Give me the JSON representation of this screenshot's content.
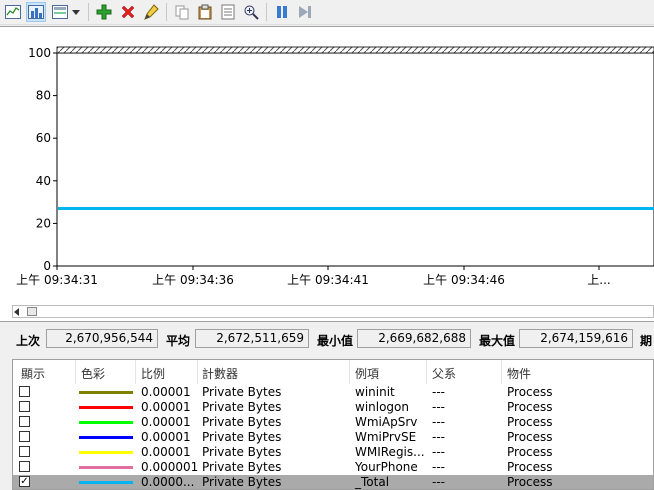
{
  "graph": {
    "y_ticks": [
      "100",
      "80",
      "60",
      "40",
      "20",
      "0"
    ],
    "x_ticks": [
      "上午 09:34:31",
      "上午 09:34:36",
      "上午 09:34:41",
      "上午 09:34:46",
      "上..."
    ],
    "line_color": "#00b4f0",
    "line_value": 27
  },
  "stats": {
    "last_label": "上次",
    "last_value": "2,670,956,544",
    "avg_label": "平均",
    "avg_value": "2,672,511,659",
    "min_label": "最小值",
    "min_value": "2,669,682,688",
    "max_label": "最大值",
    "max_value": "2,674,159,616",
    "duration_label": "期"
  },
  "table": {
    "headers": [
      "顯示",
      "色彩",
      "比例",
      "計數器",
      "例項",
      "父系",
      "物件"
    ],
    "rows": [
      {
        "checked": false,
        "color": "#808000",
        "scale": "0.00001",
        "counter": "Private Bytes",
        "instance": "wininit",
        "parent": "---",
        "object": "Process"
      },
      {
        "checked": false,
        "color": "#ff0000",
        "scale": "0.00001",
        "counter": "Private Bytes",
        "instance": "winlogon",
        "parent": "---",
        "object": "Process"
      },
      {
        "checked": false,
        "color": "#00ff00",
        "scale": "0.00001",
        "counter": "Private Bytes",
        "instance": "WmiApSrv",
        "parent": "---",
        "object": "Process"
      },
      {
        "checked": false,
        "color": "#0000ff",
        "scale": "0.00001",
        "counter": "Private Bytes",
        "instance": "WmiPrvSE",
        "parent": "---",
        "object": "Process"
      },
      {
        "checked": false,
        "color": "#ffff00",
        "scale": "0.00001",
        "counter": "Private Bytes",
        "instance": "WMIRegis...",
        "parent": "---",
        "object": "Process"
      },
      {
        "checked": false,
        "color": "#e070a0",
        "scale": "0.000001",
        "counter": "Private Bytes",
        "instance": "YourPhone",
        "parent": "---",
        "object": "Process"
      },
      {
        "checked": true,
        "color": "#00b4f0",
        "scale": "0.0000...",
        "counter": "Private Bytes",
        "instance": "_Total",
        "parent": "---",
        "object": "Process"
      }
    ]
  },
  "toolbar": {
    "icons": [
      "view-graph-icon",
      "view-histogram-icon",
      "change-graph-type-icon",
      "dropdown-arrow-icon",
      "add-counter-icon",
      "delete-counter-icon",
      "highlight-icon",
      "copy-properties-icon",
      "paste-counter-list-icon",
      "properties-icon",
      "zoom-icon",
      "freeze-display-icon",
      "update-data-icon"
    ]
  }
}
